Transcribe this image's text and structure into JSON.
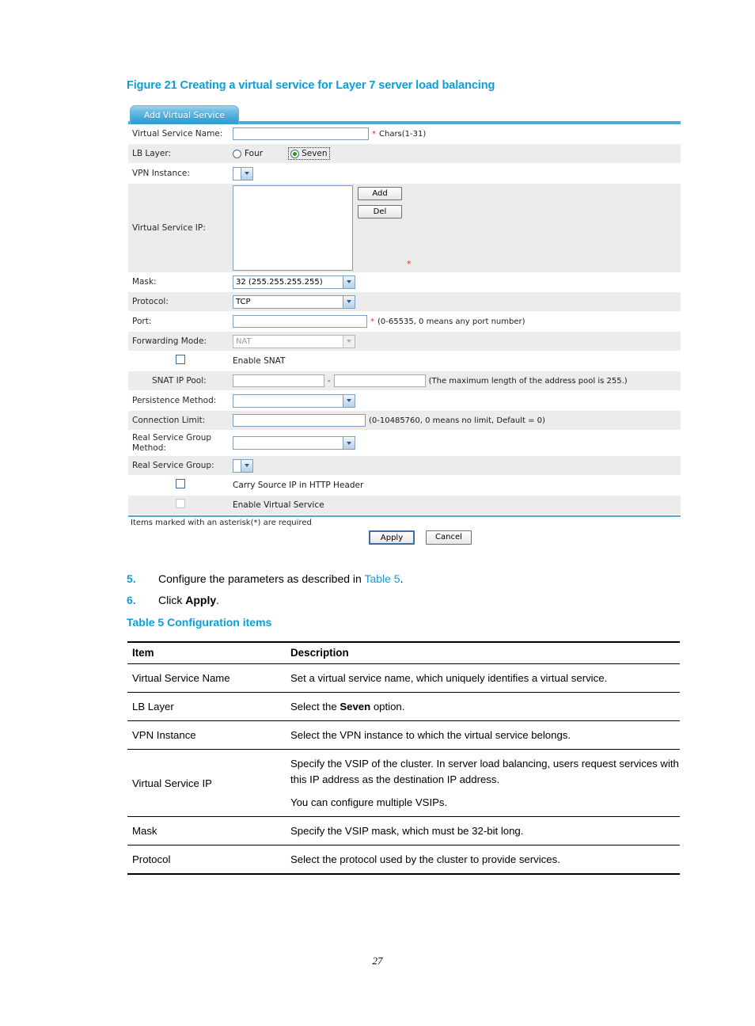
{
  "figure": {
    "caption": "Figure 21 Creating a virtual service for Layer 7 server load balancing"
  },
  "form": {
    "tab_label": "Add Virtual Service",
    "fields": {
      "virtual_service_name": {
        "label": "Virtual Service Name:",
        "value": "",
        "required_mark": "*",
        "hint": "Chars(1-31)"
      },
      "lb_layer": {
        "label": "LB Layer:",
        "options": [
          "Four",
          "Seven"
        ],
        "selected": "Seven"
      },
      "vpn_instance": {
        "label": "VPN Instance:",
        "value": ""
      },
      "virtual_service_ip": {
        "label": "Virtual Service IP:",
        "list_items": [],
        "add_label": "Add",
        "del_label": "Del",
        "required_mark": "*"
      },
      "mask": {
        "label": "Mask:",
        "value": "32 (255.255.255.255)"
      },
      "protocol": {
        "label": "Protocol:",
        "value": "TCP"
      },
      "port": {
        "label": "Port:",
        "value": "",
        "required_mark": "*",
        "hint": "(0-65535, 0 means any port number)"
      },
      "forwarding_mode": {
        "label": "Forwarding Mode:",
        "value": "NAT",
        "disabled": true
      },
      "enable_snat": {
        "label": "Enable SNAT",
        "checked": false
      },
      "snat_ip_pool": {
        "label": "SNAT IP Pool:",
        "start_value": "",
        "end_value": "",
        "separator": "-",
        "hint": "(The maximum length of the address pool is 255.)"
      },
      "persistence_method": {
        "label": "Persistence Method:",
        "value": ""
      },
      "connection_limit": {
        "label": "Connection Limit:",
        "value": "",
        "hint": "(0-10485760, 0 means no limit, Default = 0)"
      },
      "real_service_group_method": {
        "label": "Real Service Group Method:",
        "value": ""
      },
      "real_service_group": {
        "label": "Real Service Group:",
        "value": ""
      },
      "carry_source_ip": {
        "label": "Carry Source IP in HTTP Header",
        "checked": false
      },
      "enable_virtual_service": {
        "label": "Enable Virtual Service",
        "checked": false,
        "disabled": true
      }
    },
    "footnote": "Items marked with an asterisk(*) are required",
    "apply_label": "Apply",
    "cancel_label": "Cancel"
  },
  "steps": [
    {
      "number": "5.",
      "text_before": "Configure the parameters as described in ",
      "link": "Table 5",
      "text_after": "."
    },
    {
      "number": "6.",
      "text_before": "Click ",
      "bold": "Apply",
      "text_after": "."
    }
  ],
  "table": {
    "caption": "Table 5 Configuration items",
    "headers": [
      "Item",
      "Description"
    ],
    "rows": [
      {
        "item": "Virtual Service Name",
        "description": [
          "Set a virtual service name, which uniquely identifies a virtual service."
        ]
      },
      {
        "item": "LB Layer",
        "description_before": "Select the ",
        "description_bold": "Seven",
        "description_after": " option."
      },
      {
        "item": "VPN Instance",
        "description": [
          "Select the VPN instance to which the virtual service belongs."
        ]
      },
      {
        "item": "Virtual Service IP",
        "description": [
          "Specify the VSIP of the cluster. In server load balancing, users request services with this IP address as the destination IP address.",
          "You can configure multiple VSIPs."
        ]
      },
      {
        "item": "Mask",
        "description": [
          "Specify the VSIP mask, which must be 32-bit long."
        ]
      },
      {
        "item": "Protocol",
        "description": [
          "Select the protocol used by the cluster to provide services."
        ]
      }
    ]
  },
  "page_number": "27",
  "colors": {
    "accent_blue": "#0b9ed9",
    "tab_blue": "#4eabd8",
    "required_red": "#e03030"
  }
}
